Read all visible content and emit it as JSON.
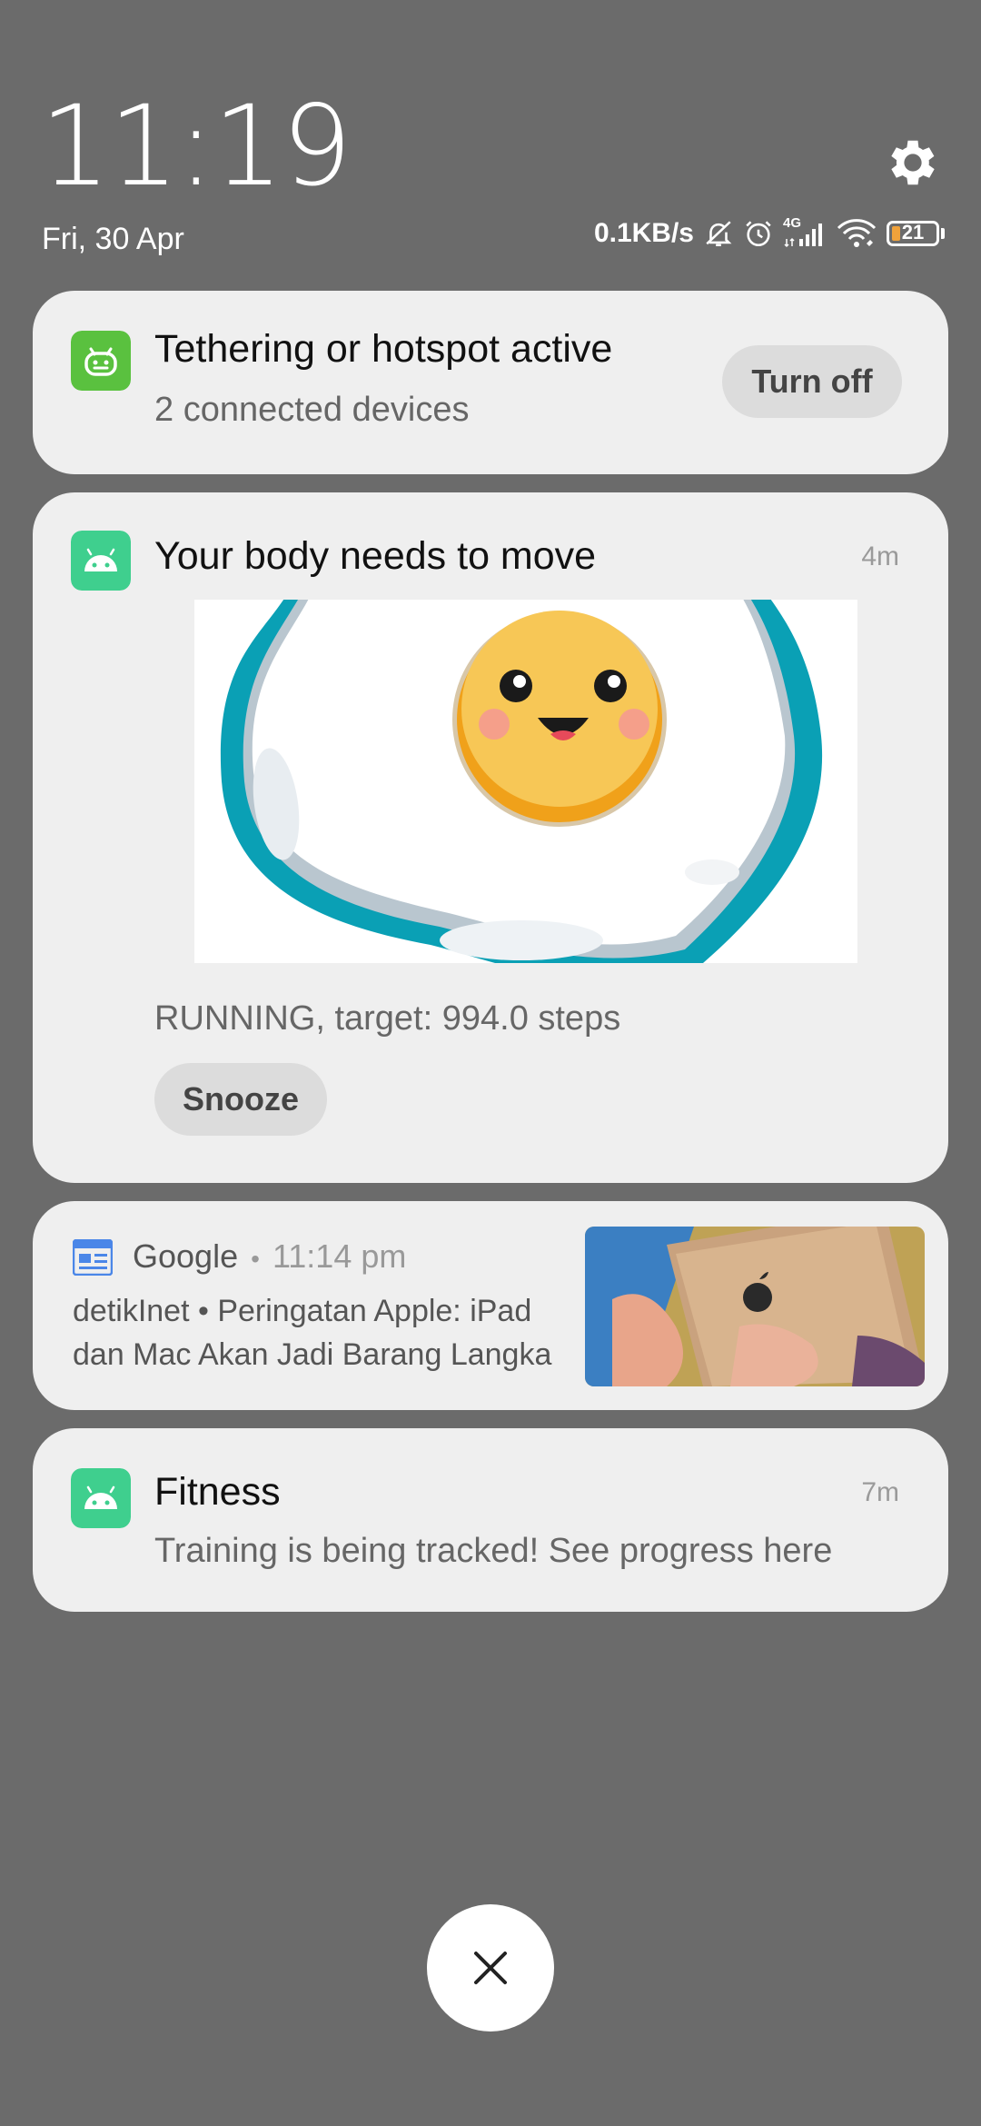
{
  "header": {
    "time": "11:19",
    "date": "Fri, 30 Apr",
    "network_speed": "0.1KB/s",
    "network_type": "4G",
    "battery_level": "21"
  },
  "notifications": {
    "tethering": {
      "title": "Tethering or hotspot active",
      "subtitle": "2 connected devices",
      "action": "Turn off"
    },
    "body_move": {
      "title": "Your body needs to move",
      "time": "4m",
      "status_text": "RUNNING, target: 994.0 steps",
      "action": "Snooze"
    },
    "google": {
      "app_name": "Google",
      "separator": "•",
      "time": "11:14 pm",
      "line1": "detikInet • Peringatan Apple: iPad",
      "line2": "dan Mac Akan Jadi Barang Langka"
    },
    "fitness": {
      "title": "Fitness",
      "time": "7m",
      "subtitle": "Training is being tracked! See progress here"
    }
  },
  "colors": {
    "background": "#6b6b6b",
    "card": "#efefef",
    "hotspot_icon": "#5ac13f",
    "android_icon": "#3fcf8e",
    "google_news_icon": "#4a86e8",
    "egg_border": "#0aa0b5"
  },
  "icons": [
    "settings-gear-icon",
    "mute-bell-icon",
    "alarm-icon",
    "signal-icon",
    "wifi-icon",
    "battery-icon",
    "hotspot-icon",
    "android-icon",
    "google-news-icon",
    "close-icon"
  ]
}
